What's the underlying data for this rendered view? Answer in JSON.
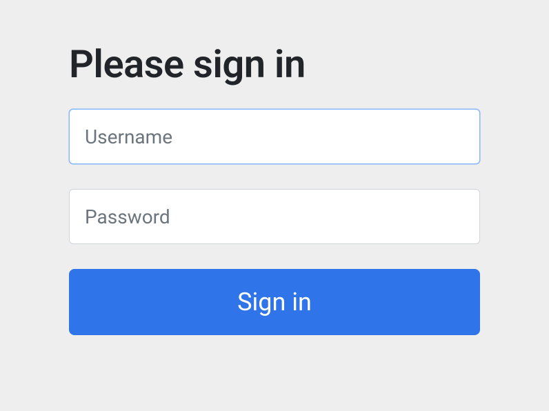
{
  "heading": "Please sign in",
  "username": {
    "placeholder": "Username",
    "value": ""
  },
  "password": {
    "placeholder": "Password",
    "value": ""
  },
  "submit_label": "Sign in"
}
